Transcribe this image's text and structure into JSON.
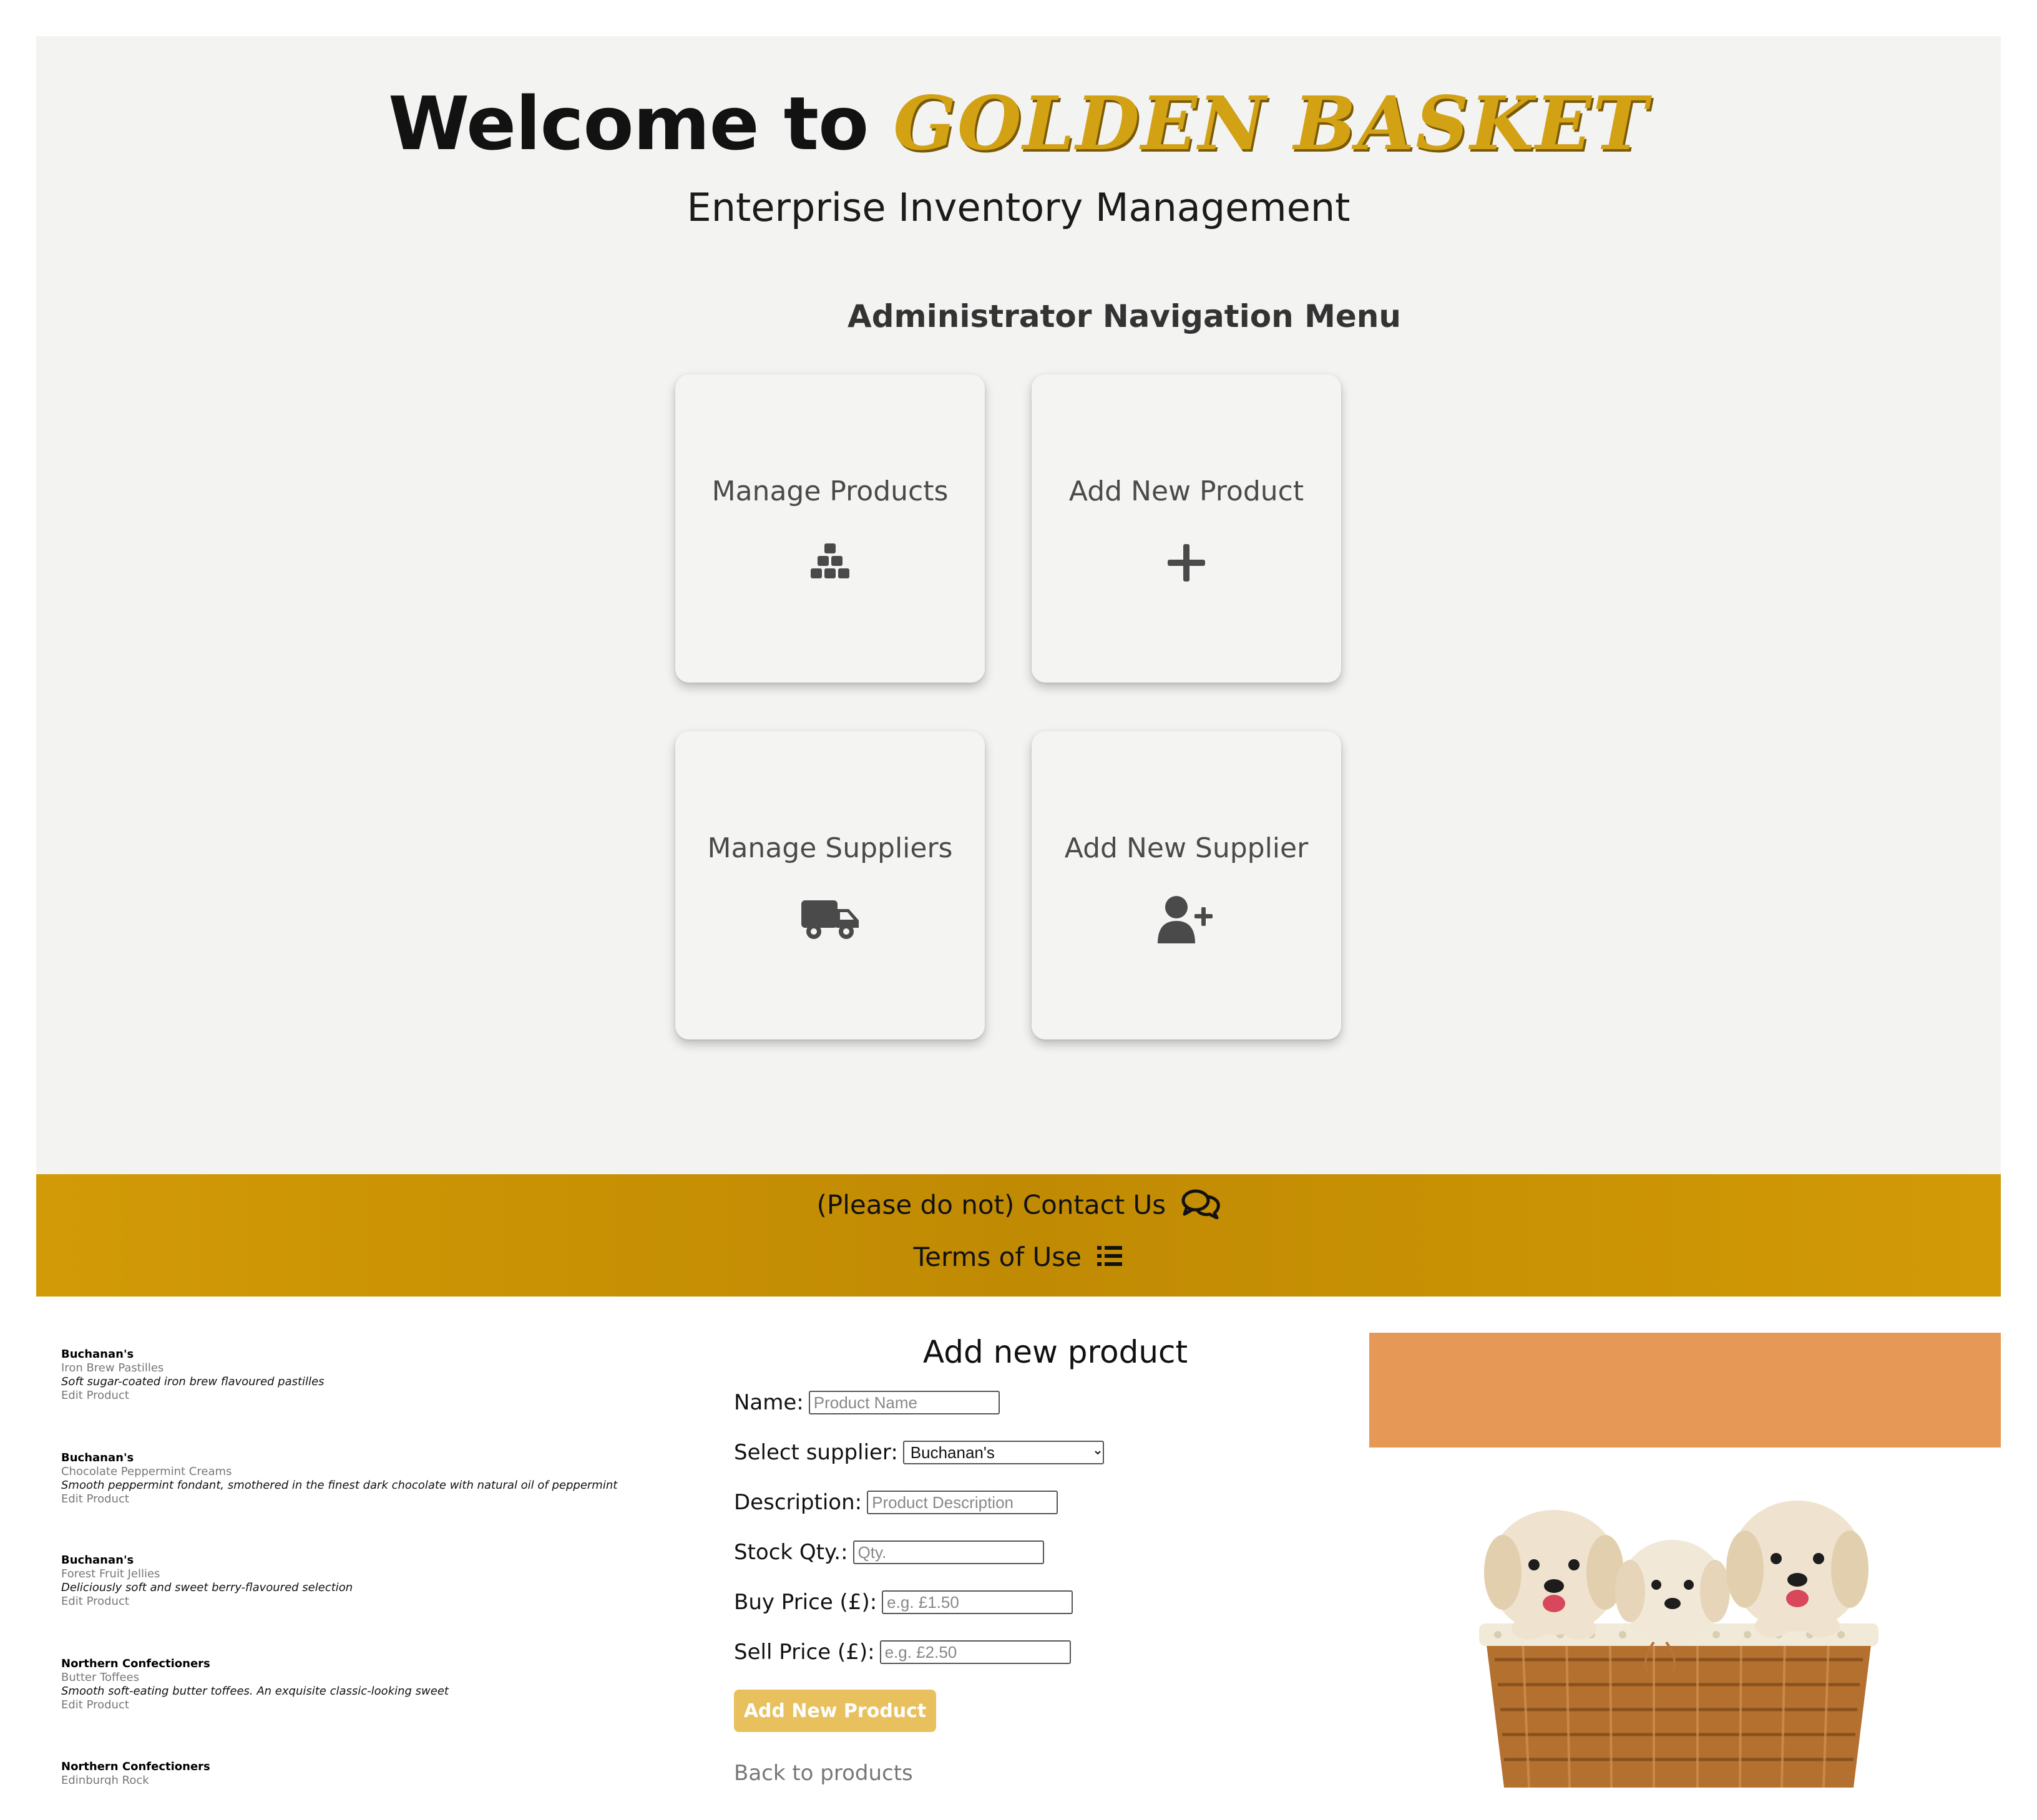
{
  "header": {
    "welcome_prefix": "Welcome to",
    "brand": "Golden Basket",
    "subtitle": "Enterprise Inventory Management"
  },
  "nav": {
    "heading": "Administrator Navigation Menu",
    "cards": [
      {
        "label": "Manage Products",
        "icon": "cubes-icon"
      },
      {
        "label": "Add New Product",
        "icon": "plus-icon"
      },
      {
        "label": "Manage Suppliers",
        "icon": "truck-icon"
      },
      {
        "label": "Add New Supplier",
        "icon": "user-plus-icon"
      }
    ]
  },
  "footer": {
    "contact": "(Please do not) Contact Us",
    "contact_icon": "comments-icon",
    "terms": "Terms of Use",
    "terms_icon": "list-icon"
  },
  "products": [
    {
      "supplier": "Buchanan's",
      "name": "Iron Brew Pastilles",
      "description": "Soft sugar-coated iron brew flavoured pastilles",
      "edit": "Edit Product"
    },
    {
      "supplier": "Buchanan's",
      "name": "Chocolate Peppermint Creams",
      "description": "Smooth peppermint fondant, smothered in the finest dark chocolate with natural oil of peppermint",
      "edit": "Edit Product"
    },
    {
      "supplier": "Buchanan's",
      "name": "Forest Fruit Jellies",
      "description": "Deliciously soft and sweet berry-flavoured selection",
      "edit": "Edit Product"
    },
    {
      "supplier": "Northern Confectioners",
      "name": "Butter Toffees",
      "description": "Smooth soft-eating butter toffees. An exquisite classic-looking sweet",
      "edit": "Edit Product"
    },
    {
      "supplier": "Northern Confectioners",
      "name": "Edinburgh Rock",
      "description": "",
      "edit": ""
    }
  ],
  "form": {
    "title": "Add new product",
    "name_label": "Name:",
    "name_placeholder": "Product Name",
    "supplier_label": "Select supplier:",
    "supplier_selected": "Buchanan's",
    "description_label": "Description:",
    "description_placeholder": "Product Description",
    "qty_label": "Stock Qty.:",
    "qty_placeholder": "Qty.",
    "buy_label": "Buy Price (£):",
    "buy_placeholder": "e.g. £1.50",
    "sell_label": "Sell Price (£):",
    "sell_placeholder": "e.g. £2.50",
    "submit": "Add New Product",
    "back": "Back to products"
  },
  "colors": {
    "brand_gold": "#d3a214",
    "footer_gold": "#c99104",
    "button_gold": "#e8c05e",
    "orange_block": "#e69856",
    "panel_bg": "#f3f3f2"
  }
}
